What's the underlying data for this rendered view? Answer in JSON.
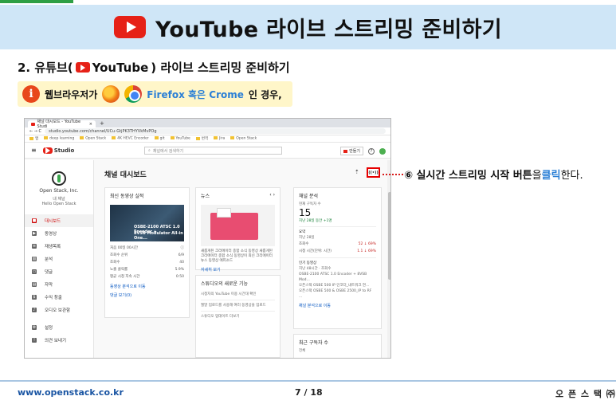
{
  "slide": {
    "title": "YouTube 라이브 스트리밍 준비하기",
    "subheading_prefix": "2. 유튜브(",
    "subheading_brand": "YouTube",
    "subheading_suffix": ") 라이브 스트리밍 준비하기",
    "note_prefix": "웹브라우저가",
    "note_browsers": "Firefox 혹은 Crome",
    "note_suffix": "인 경우,",
    "info_glyph": "i",
    "colors": {
      "accent_green": "#2e9f44",
      "title_bg": "#cfe6f7",
      "youtube_red": "#e62117",
      "note_bg": "#fff6c9",
      "link_blue": "#2a7fd6",
      "highlight_red": "#e60000"
    }
  },
  "callout": {
    "number": "⑥",
    "text_before": "실시간 스트리밍 시작 버튼",
    "particle": "을",
    "highlight": "클릭",
    "text_after": "한다."
  },
  "browser": {
    "tab_title": "채널 대시보드 - YouTube Studi",
    "tab_close": "×",
    "tab_new": "+",
    "nav_buttons": "← → C",
    "url": "studio.youtube.com/channel/UCu-GtjPK3THYVkMvPOg",
    "bookmarks": [
      "앱",
      "deep learning",
      "Open Stack",
      "4K HEVC Encoder",
      "git",
      "YouTube",
      "번역",
      "Jira",
      "Open Stack"
    ]
  },
  "studio": {
    "hamburger": "≡",
    "logo_text": "Studio",
    "search_placeholder": "채널에서 검색하기",
    "create_label": "만들기",
    "help_glyph": "?",
    "page_title": "채널 대시보드",
    "upload_glyph": "⇡",
    "live_button_glyph": "((•))",
    "channel_name": "Open Stack, Inc.",
    "channel_label": "내 채널",
    "channel_sub": "Hello Open Stack",
    "nav": [
      {
        "label": "대시보드",
        "icon": "■"
      },
      {
        "label": "동영상",
        "icon": "▶"
      },
      {
        "label": "재생목록",
        "icon": "≡"
      },
      {
        "label": "분석",
        "icon": "▥"
      },
      {
        "label": "댓글",
        "icon": "▭"
      },
      {
        "label": "자막",
        "icon": "▤"
      },
      {
        "label": "수익 창출",
        "icon": "$"
      },
      {
        "label": "오디오 보관함",
        "icon": "♪"
      },
      {
        "label": "설정",
        "icon": "⚙"
      },
      {
        "label": "의견 보내기",
        "icon": "!"
      }
    ],
    "latest_video": {
      "title": "최신 동영상 실적",
      "thumb_line1": "OSBE-2100 ATSC 1.0 Encoder +",
      "thumb_line2": "8VSB Modulator All-in One...",
      "period": "처음 00일 00시간",
      "rows": [
        {
          "k": "조회수 순위",
          "v": "6/9"
        },
        {
          "k": "조회수",
          "v": "40"
        },
        {
          "k": "노출 클릭률",
          "v": "5.9%"
        },
        {
          "k": "평균 시청 지속 시간",
          "v": "0:50"
        }
      ],
      "link1": "동영상 분석으로 이동",
      "link2": "댓글 보기(0)"
    },
    "news": {
      "title": "뉴스",
      "arrows": "‹  ›",
      "text": "새롭게된 크리에이터 종합 소식 동영상 새롭게된 크리에이터 종합 소식 동영상이 최신 크리에이터 뉴스 동영상 에피소드",
      "link": "자세히 보기"
    },
    "whats_new": {
      "title": "스튜디오의 새로운 기능",
      "items": [
        "시청자의 YouTube 이용 시간대 확인",
        "월말 업로드를 사용해 여러 동영상을 업로드",
        "스튜디오 업데이트 더보기"
      ]
    },
    "analytics": {
      "title": "채널 분석",
      "subs_label": "현재 구독자 수",
      "subs_value": "15",
      "subs_change": "지난 28일 동안 +1명",
      "summary_title": "요약",
      "summary_period": "지난 28일",
      "rows": [
        {
          "k": "조회수",
          "v": "52 ↓ 69%"
        },
        {
          "k": "시청 시간(단위: 시간)",
          "v": "1.1 ↓ 69%"
        }
      ],
      "top_title": "인기 동영상",
      "top_period": "지난 48시간 · 조회수",
      "top_videos": [
        "OSBE-2100 ATSC 1.0 Encoder + 8VSB Mod...",
        "오픈스택 OSBE 500 IP 인코더_내트워크 연...",
        "오픈스택 OSBE 500 & OSBE 2500_IP to RF ..."
      ],
      "link": "채널 분석으로 이동"
    },
    "recent_subs": {
      "title": "최근 구독자 수",
      "period": "전체"
    }
  },
  "footer": {
    "url": "www.openstack.co.kr",
    "page": "7 / 18",
    "brand": "오 픈 스 택 ㈜"
  }
}
